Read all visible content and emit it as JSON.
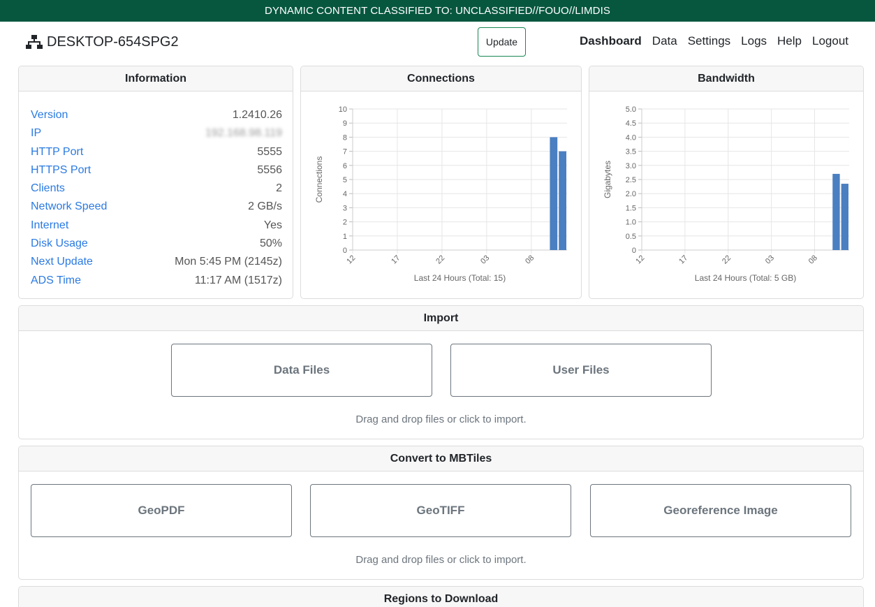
{
  "banner": {
    "text": "DYNAMIC CONTENT CLASSIFIED TO: UNCLASSIFIED//FOUO//LIMDIS"
  },
  "header": {
    "hostname": "DESKTOP-654SPG2",
    "update_label": "Update",
    "nav": [
      "Dashboard",
      "Data",
      "Settings",
      "Logs",
      "Help",
      "Logout"
    ],
    "active_nav": "Dashboard"
  },
  "information": {
    "title": "Information",
    "rows": [
      {
        "key": "Version",
        "value": "1.2410.26"
      },
      {
        "key": "IP",
        "value": "192.168.98.119"
      },
      {
        "key": "HTTP Port",
        "value": "5555"
      },
      {
        "key": "HTTPS Port",
        "value": "5556"
      },
      {
        "key": "Clients",
        "value": "2"
      },
      {
        "key": "Network Speed",
        "value": "2 GB/s"
      },
      {
        "key": "Internet",
        "value": "Yes"
      },
      {
        "key": "Disk Usage",
        "value": "50%"
      },
      {
        "key": "Next Update",
        "value": "Mon 5:45 PM (2145z)"
      },
      {
        "key": "ADS Time",
        "value": "11:17 AM (1517z)"
      }
    ]
  },
  "chart_data": [
    {
      "type": "bar",
      "title": "Connections",
      "ylabel": "Connections",
      "xlabel": "Last 24 Hours (Total: 15)",
      "ylim": [
        0,
        10
      ],
      "yticks": [
        "0",
        "1",
        "2",
        "3",
        "4",
        "5",
        "6",
        "7",
        "8",
        "9",
        "10"
      ],
      "xticks": [
        "12",
        "17",
        "22",
        "03",
        "08"
      ],
      "bars": [
        {
          "hour_index": 22,
          "value": 8
        },
        {
          "hour_index": 23,
          "value": 7
        }
      ],
      "grid": true,
      "bar_color": "#4a7fc1"
    },
    {
      "type": "bar",
      "title": "Bandwidth",
      "ylabel": "Gigabytes",
      "xlabel": "Last 24 Hours (Total: 5 GB)",
      "ylim": [
        0,
        5
      ],
      "yticks": [
        "0",
        "0.5",
        "1.0",
        "1.5",
        "2.0",
        "2.5",
        "3.0",
        "3.5",
        "4.0",
        "4.5",
        "5.0"
      ],
      "xticks": [
        "12",
        "17",
        "22",
        "03",
        "08"
      ],
      "bars": [
        {
          "hour_index": 22,
          "value": 2.7
        },
        {
          "hour_index": 23,
          "value": 2.35
        }
      ],
      "grid": true,
      "bar_color": "#4a7fc1"
    }
  ],
  "import": {
    "title": "Import",
    "buttons": [
      "Data Files",
      "User Files"
    ],
    "hint": "Drag and drop files or click to import."
  },
  "convert": {
    "title": "Convert to MBTiles",
    "buttons": [
      "GeoPDF",
      "GeoTIFF",
      "Georeference Image"
    ],
    "hint": "Drag and drop files or click to import."
  },
  "regions": {
    "title": "Regions to Download"
  },
  "colors": {
    "banner": "#07573f",
    "link": "#2a7ae2",
    "bar": "#4a7fc1",
    "button_border": "#6c757d"
  }
}
